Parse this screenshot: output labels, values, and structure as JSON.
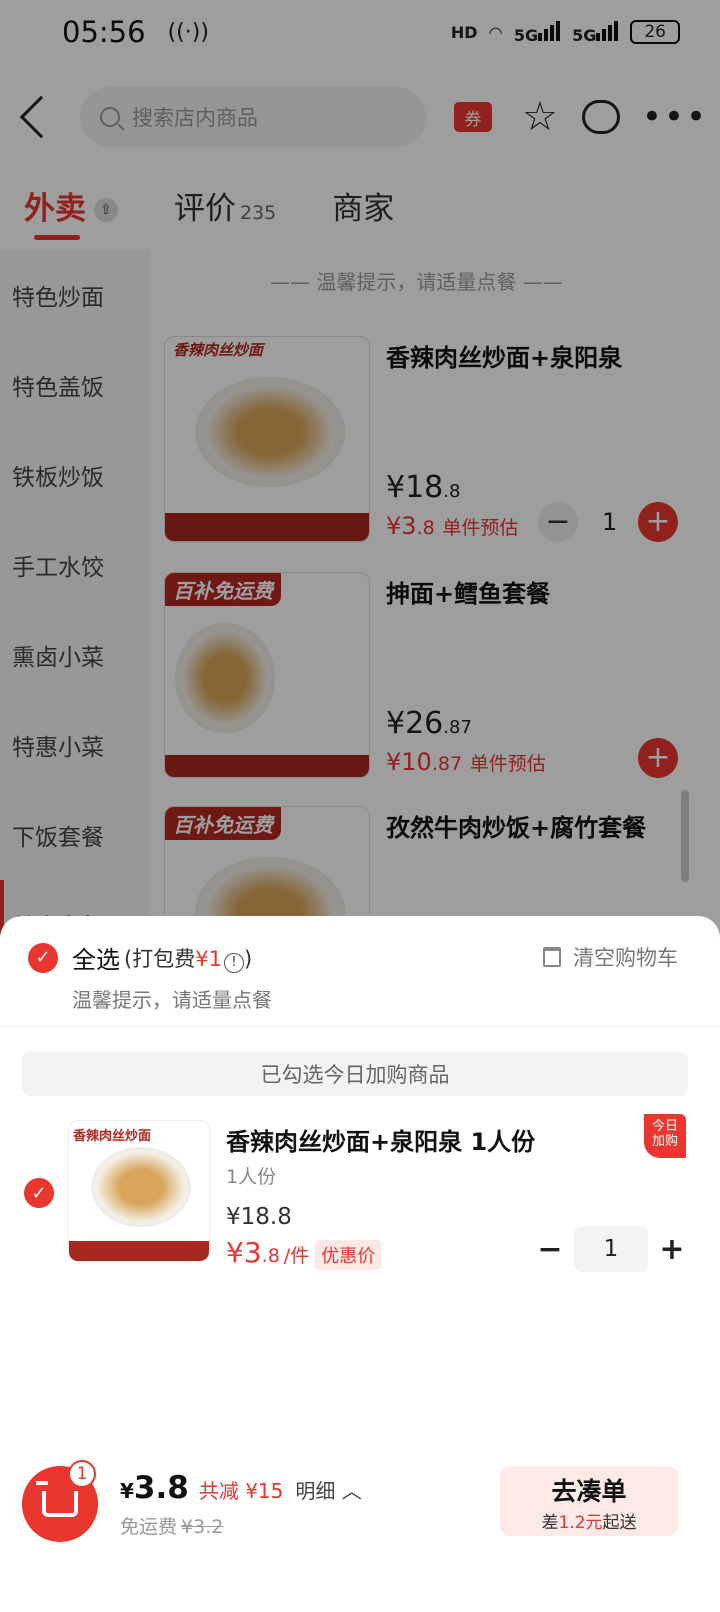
{
  "status_bar": {
    "time": "05:56",
    "hd": "HD",
    "net1": "5G",
    "net2": "5G",
    "battery": "26"
  },
  "header": {
    "search_placeholder": "搜索店内商品",
    "coupon": "券"
  },
  "tabs": [
    {
      "label": "外卖"
    },
    {
      "label": "评价",
      "count": "235"
    },
    {
      "label": "商家"
    }
  ],
  "sidebar": {
    "items": [
      "特色炒面",
      "特色盖饭",
      "铁板炒饭",
      "手工水饺",
      "熏卤小菜",
      "特惠小菜",
      "下饭套餐",
      "单人套餐"
    ]
  },
  "menu": {
    "tip": "温馨提示，请适量点餐",
    "products": [
      {
        "name": "香辣肉丝炒面+泉阳泉",
        "img_text": "香辣肉丝炒面",
        "price_int": "18",
        "price_dec": ".8",
        "est_int": "3",
        "est_dec": ".8",
        "est_label": "单件预估",
        "qty": "1"
      },
      {
        "name": "抻面+鳕鱼套餐",
        "img_text": "百补免运费",
        "price_int": "26",
        "price_dec": ".87",
        "est_int": "10",
        "est_dec": ".87",
        "est_label": "单件预估"
      },
      {
        "name": "孜然牛肉炒饭+腐竹套餐",
        "img_text": "百补免运费"
      }
    ]
  },
  "cart": {
    "select_all": "全选",
    "pack_prefix": "(打包费",
    "pack_fee": "¥1",
    "pack_suffix": ")",
    "clear": "清空购物车",
    "tip": "温馨提示，请适量点餐",
    "section_title": "已勾选今日加购商品",
    "item": {
      "name": "香辣肉丝炒面+泉阳泉 1人份",
      "spec": "1人份",
      "orig_price": "¥18.8",
      "deal_int": "3",
      "deal_dec": ".8",
      "unit": "/件",
      "badge": "优惠价",
      "corner_line1": "今日",
      "corner_line2": "加购",
      "thumb_text": "香辣肉丝炒面",
      "qty": "1"
    }
  },
  "bottom_bar": {
    "cart_count": "1",
    "total_int": "3.8",
    "reduce": "共减 ¥15",
    "detail": "明细",
    "ship_label": "免运费",
    "ship_orig": "¥3.2",
    "go_label": "去凑单",
    "go_prefix": "差",
    "go_amount": "1.2元",
    "go_suffix": "起送"
  },
  "colors": {
    "accent": "#e9362f",
    "overlay": "rgba(0,0,0,0.38)"
  }
}
